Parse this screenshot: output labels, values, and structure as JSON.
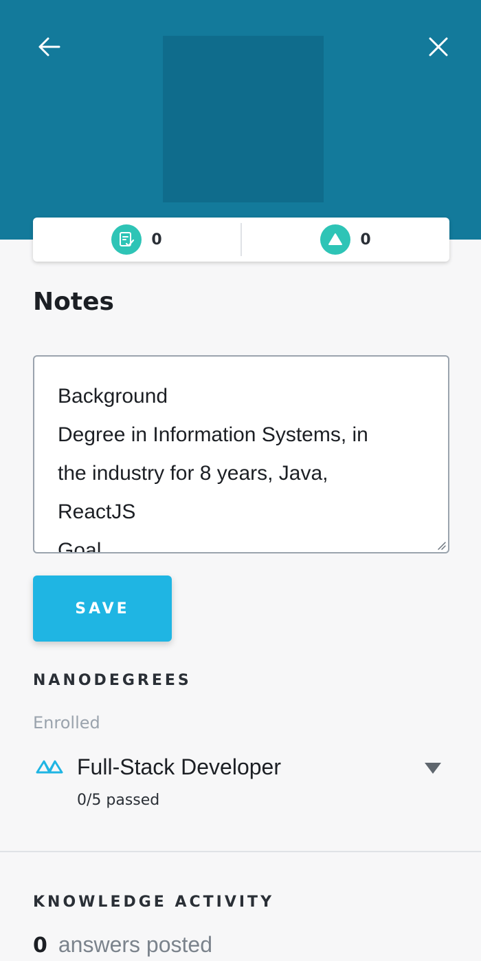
{
  "header": {
    "back_icon": "arrow-left-icon",
    "close_icon": "close-icon",
    "avatar": "profile-avatar",
    "background_color": "#137a9b"
  },
  "stats": {
    "notes_count": "0",
    "notes_icon": "edit-checklist-icon",
    "upvotes_count": "0",
    "upvotes_icon": "triangle-up-icon",
    "icon_color": "#2ec4b6"
  },
  "notes": {
    "title": "Notes",
    "lines": [
      "Background",
      "Degree in Information Systems, in",
      "the industry for 8 years, Java,",
      "ReactJS",
      "Goal"
    ]
  },
  "save_button": {
    "label": "SAVE",
    "color": "#1fb5e3"
  },
  "nanodegrees": {
    "section_title": "NANODEGREES",
    "enrolled_label": "Enrolled",
    "items": [
      {
        "logo_icon": "udacity-logo-icon",
        "title": "Full-Stack Developer",
        "progress": "0/5 passed",
        "caret_icon": "caret-down-icon"
      }
    ]
  },
  "knowledge_activity": {
    "section_title": "KNOWLEDGE ACTIVITY",
    "answers_count": "0",
    "answers_label": "answers posted"
  }
}
